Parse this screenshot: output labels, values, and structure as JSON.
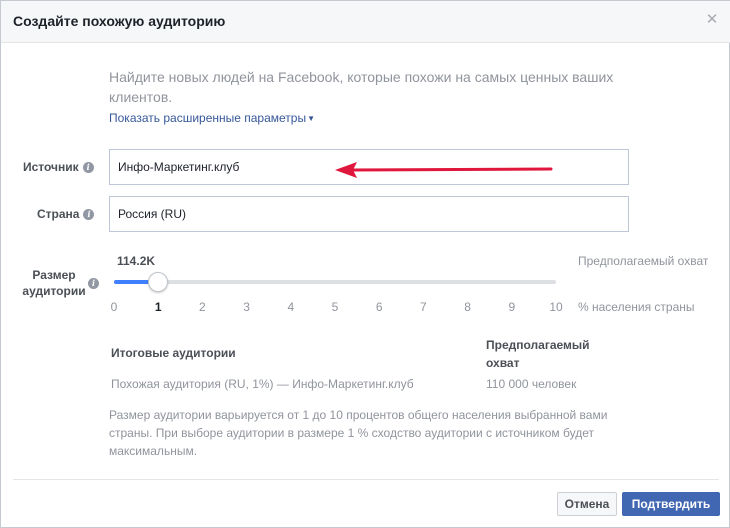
{
  "dialog": {
    "title": "Создайте похожую аудиторию",
    "close_icon": "close-icon"
  },
  "intro": {
    "text": "Найдите новых людей на Facebook, которые похожи на самых ценных ваших клиентов.",
    "advanced_link": "Показать расширенные параметры"
  },
  "source": {
    "label": "Источник",
    "value": "Инфо-Маркетинг.клуб"
  },
  "country": {
    "label": "Страна",
    "value": "Россия (RU)"
  },
  "audience_size": {
    "label_line1": "Размер",
    "label_line2": "аудитории",
    "estimated_count": "114.2K",
    "reach_label": "Предполагаемый охват",
    "selected": 1,
    "ticks": [
      "0",
      "1",
      "2",
      "3",
      "4",
      "5",
      "6",
      "7",
      "8",
      "9",
      "10"
    ],
    "percent_label": "% населения страны"
  },
  "summary": {
    "col1_header": "Итоговые аудитории",
    "col2_header": "Предполагаемый охват",
    "row_name": "Похожая аудитория (RU, 1%) — Инфо-Маркетинг.клуб",
    "row_reach": "110 000 человек"
  },
  "note": "Размер аудитории варьируется от 1 до 10 процентов общего населения выбранной вами страны. При выборе аудитории в размере 1 % сходство аудитории с источником будет максимальным.",
  "footer": {
    "cancel": "Отмена",
    "confirm": "Подтвердить"
  },
  "colors": {
    "accent": "#4267b2",
    "link": "#365899",
    "slider_fill": "#4080ff",
    "arrow": "#e0173c"
  }
}
